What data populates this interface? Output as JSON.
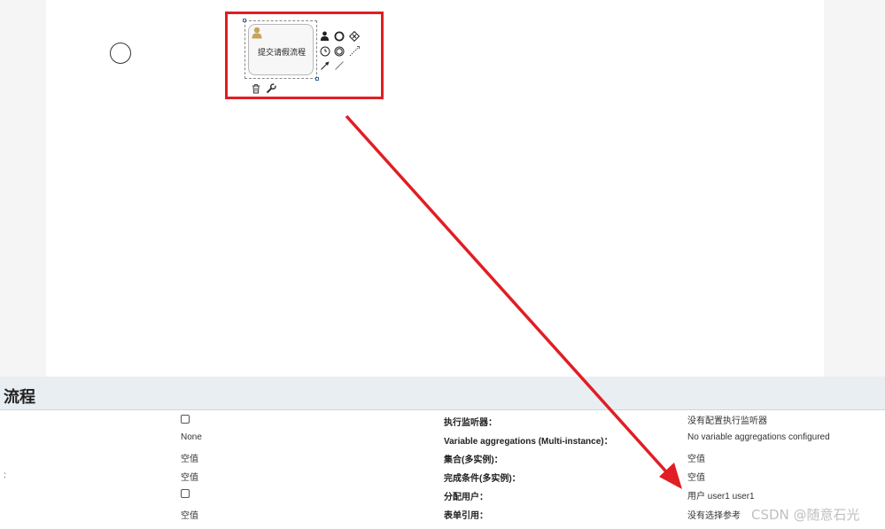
{
  "canvas": {
    "task": {
      "label": "提交请假流程"
    }
  },
  "panel": {
    "title": "流程",
    "left_colon": ":",
    "col2_values": [
      "",
      "None",
      "空值",
      "空值",
      "",
      "空值"
    ],
    "col3_labels": [
      "执行监听器：",
      "Variable aggregations (Multi-instance)：",
      "集合(多实例)：",
      "完成条件(多实例)：",
      "分配用户：",
      "表单引用："
    ],
    "col4_values": [
      "没有配置执行监听器",
      "No variable aggregations configured",
      "空值",
      "空值",
      "用户 user1 user1",
      "没有选择参考"
    ]
  },
  "annotation": {
    "color": "#e01e24"
  },
  "watermark": "CSDN @随意石光"
}
